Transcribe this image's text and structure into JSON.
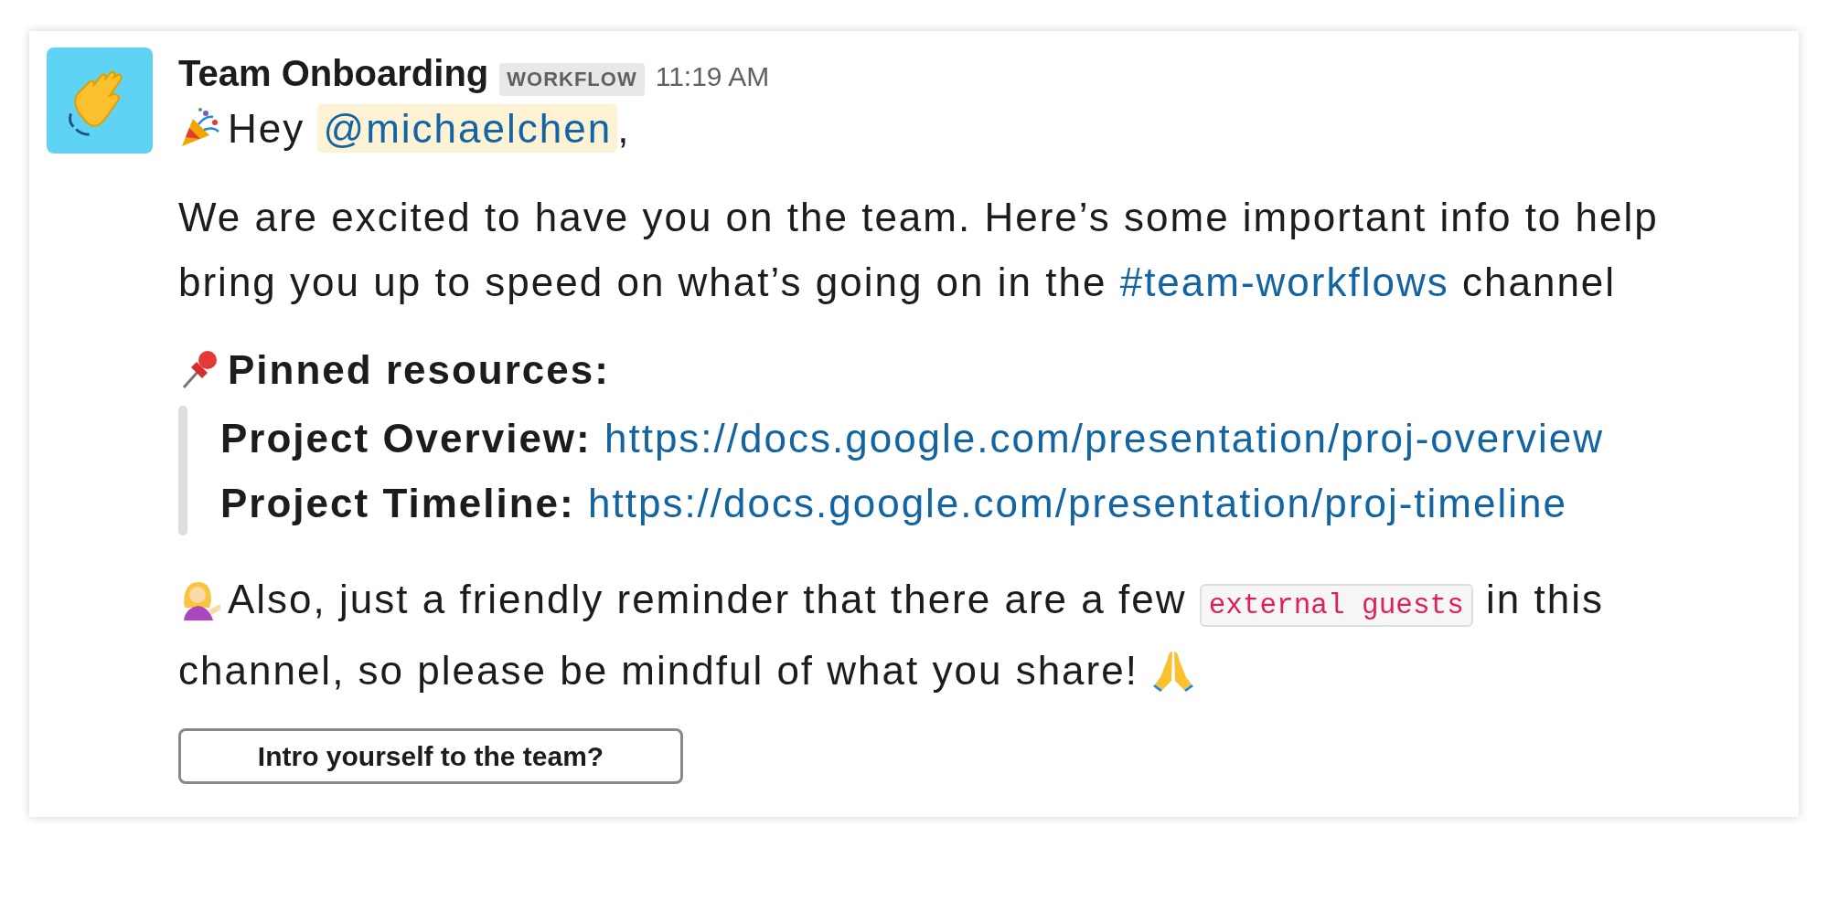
{
  "author": {
    "name": "Team Onboarding",
    "badge": "WORKFLOW",
    "time": "11:19 AM"
  },
  "greeting": {
    "prefix": "Hey",
    "mention": "@michaelchen",
    "suffix": ","
  },
  "intro": {
    "before": "We are excited to have you on the team. Here’s some important info to help bring you up to speed on what’s going on in the",
    "channel": "#team-workflows",
    "after": "channel"
  },
  "pinned": {
    "heading": "Pinned resources:",
    "items": [
      {
        "label": "Project Overview:",
        "url": "https://docs.google.com/presentation/proj-overview"
      },
      {
        "label": "Project Timeline:",
        "url": "https://docs.google.com/presentation/proj-timeline"
      }
    ]
  },
  "reminder": {
    "before": "Also, just a friendly reminder that there are a few",
    "code": "external guests",
    "after": "in this channel, so please be mindful of what you share!"
  },
  "button": "Intro yourself to the team?"
}
